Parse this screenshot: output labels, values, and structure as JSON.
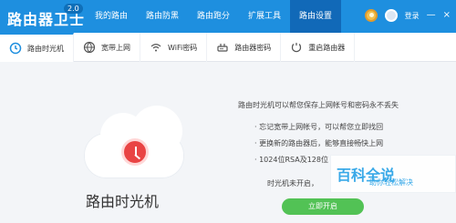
{
  "app": {
    "name": "路由器卫士",
    "version": "2.0"
  },
  "nav": {
    "items": [
      {
        "label": "我的路由"
      },
      {
        "label": "路由防黑"
      },
      {
        "label": "路由跑分"
      },
      {
        "label": "扩展工具"
      },
      {
        "label": "路由设置"
      }
    ],
    "active_index": 4,
    "login_label": "登录"
  },
  "tabs": {
    "items": [
      {
        "label": "路由时光机",
        "icon": "clock-icon"
      },
      {
        "label": "宽带上网",
        "icon": "globe-icon"
      },
      {
        "label": "WiFi密码",
        "icon": "wifi-icon"
      },
      {
        "label": "路由器密码",
        "icon": "router-icon"
      },
      {
        "label": "重启路由器",
        "icon": "restart-icon"
      }
    ],
    "active_index": 0
  },
  "main": {
    "title": "路由时光机",
    "headline": "路由时光机可以帮您保存上网帐号和密码永不丢失",
    "bullets": [
      "· 忘记宽带上网帐号，可以帮您立即找回",
      "· 更换新的路由器后，能够直接畅快上网",
      "· 1024位RSA及128位"
    ],
    "note": "时光机未开启，",
    "cta": "立即开启"
  },
  "watermark": {
    "title": "百科全说",
    "subtitle": "助你轻松解决"
  }
}
